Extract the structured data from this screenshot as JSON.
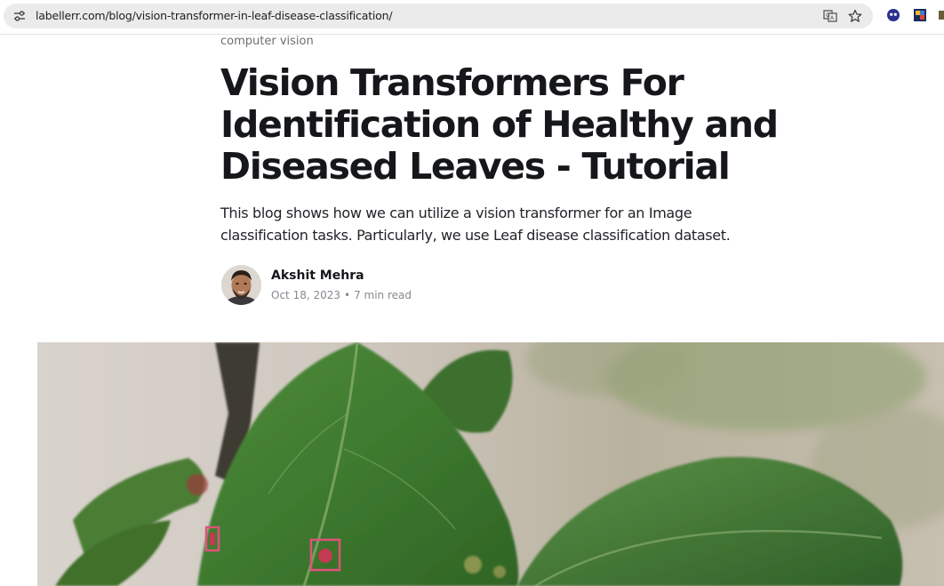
{
  "browser": {
    "url": "labellerr.com/blog/vision-transformer-in-leaf-disease-classification/",
    "icons": [
      "site-info-icon",
      "translate-icon",
      "bookmark-star-icon",
      "extension-face-icon",
      "extension-cube-icon"
    ]
  },
  "article": {
    "category": "computer vision",
    "title": "Vision Transformers For Identification of Healthy and Diseased Leaves - Tutorial",
    "excerpt": "This blog shows how we can utilize a vision transformer for an Image classification tasks. Particularly, we use Leaf disease classification dataset.",
    "author": {
      "name": "Akshit Mehra",
      "date": "Oct 18, 2023",
      "separator": "•",
      "read_time": "7 min read"
    }
  },
  "colors": {
    "title": "#15171a",
    "meta": "#858a90",
    "omnibox": "#ebebeb"
  }
}
